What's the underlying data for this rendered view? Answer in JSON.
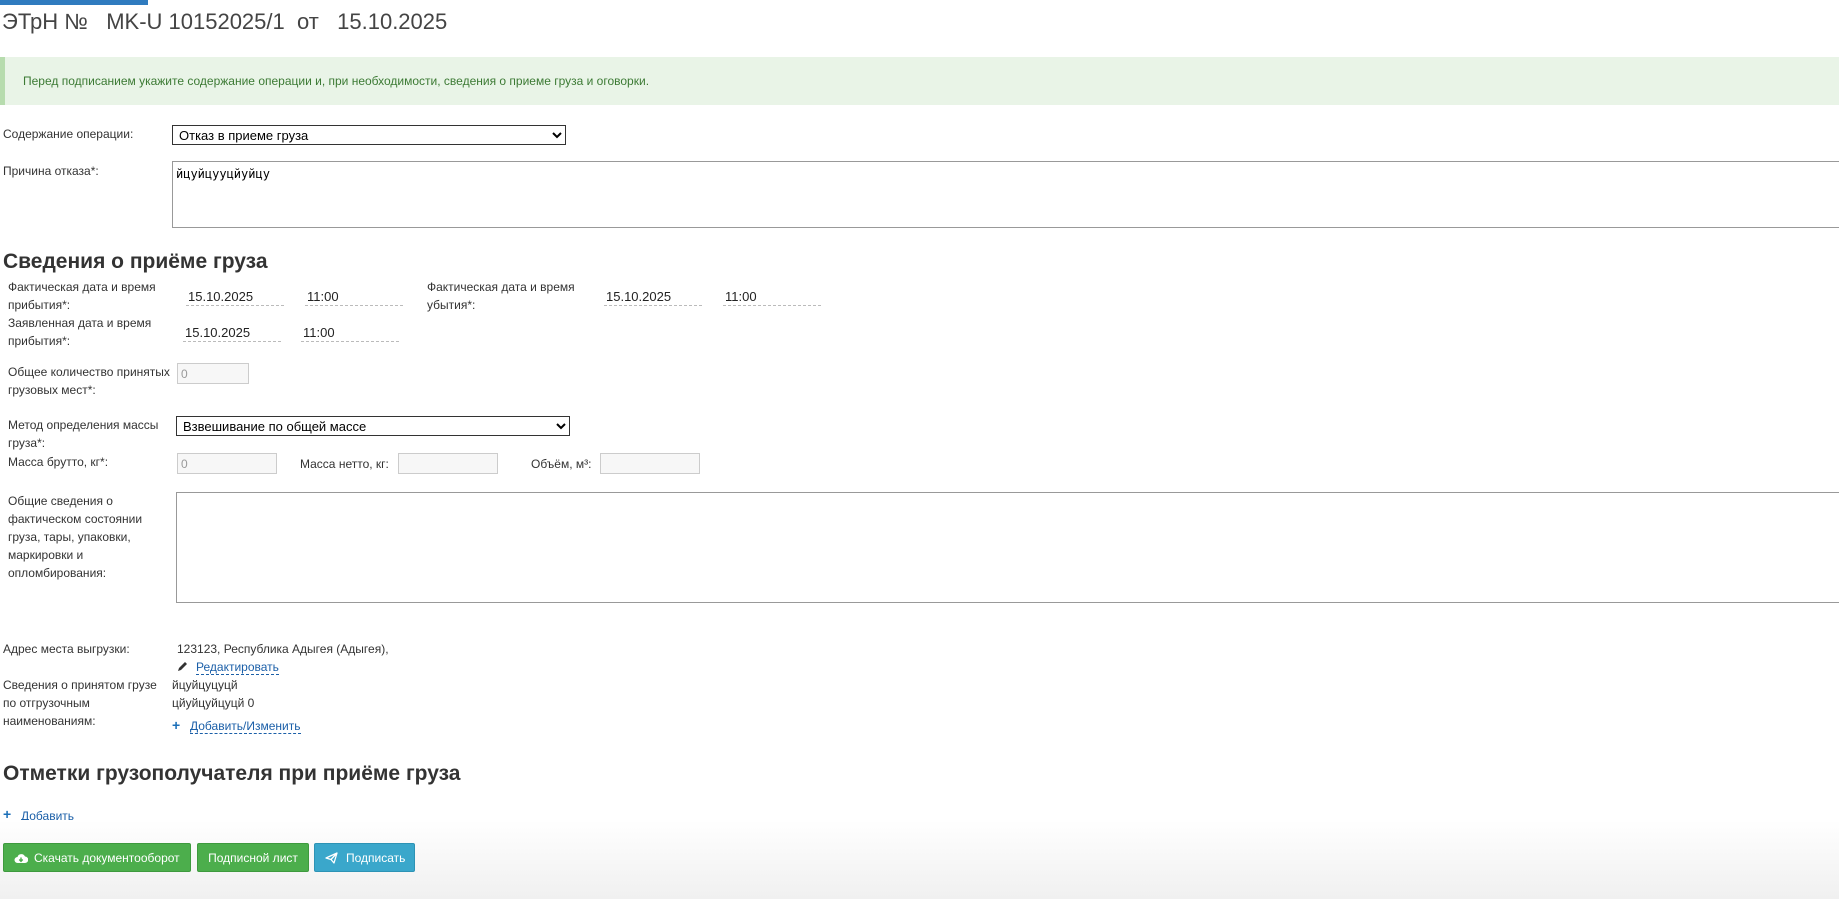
{
  "header": {
    "title": "ЭТрН №   MK-U 10152025/1  от   15.10.2025"
  },
  "notice": {
    "text": "Перед подписанием укажите содержание операции и, при необходимости, сведения о приеме груза и оговорки."
  },
  "operation": {
    "label": "Содержание операции:",
    "selected": "Отказ в приеме груза"
  },
  "refusal": {
    "label": "Причина отказа*:",
    "value": "йцуйцууцйуйцу"
  },
  "cargo_receipt": {
    "heading": "Сведения о приёме груза",
    "actual_arrival": {
      "label": "Фактическая дата и время прибытия*:",
      "date": "15.10.2025",
      "time": "11:00"
    },
    "actual_departure": {
      "label": "Фактическая дата и время убытия*:",
      "date": "15.10.2025",
      "time": "11:00"
    },
    "declared_arrival": {
      "label": "Заявленная дата и время прибытия*:",
      "date": "15.10.2025",
      "time": "11:00"
    },
    "places": {
      "label": "Общее количество принятых грузовых мест*:",
      "value": "0"
    },
    "mass_method": {
      "label": "Метод определения массы груза*:",
      "selected": "Взвешивание по общей массе"
    },
    "gross": {
      "label": "Масса брутто, кг*:",
      "value": "0"
    },
    "net": {
      "label": "Масса нетто, кг:",
      "value": ""
    },
    "volume": {
      "label": "Объём, м³:",
      "value": ""
    },
    "condition": {
      "label": "Общие сведения о фактическом состоянии груза, тары, упаковки, маркировки и опломбирования:",
      "value": ""
    },
    "unload_address": {
      "label": "Адрес места выгрузки:",
      "value": "123123, Республика Адыгея (Адыгея),",
      "edit_link": "Редактировать"
    },
    "shipping_items": {
      "label": "Сведения о принятом грузе по отгрузочным наименованиям:",
      "line1": "йцуйцуцуцй",
      "line2": "цйуйцуйцуцй 0",
      "add_link": "Добавить/Изменить"
    }
  },
  "consignee_marks": {
    "heading": "Отметки грузополучателя при приёме груза",
    "add_link": "Добавить"
  },
  "actions": {
    "download": "Скачать документооборот",
    "signature_sheet": "Подписной лист",
    "sign": "Подписать"
  },
  "colors": {
    "accent_blue": "#2f7bbf",
    "notice_bg": "#e9f4e7",
    "notice_text": "#3c7a34",
    "button_green": "#4cae4c",
    "button_blue": "#3aa7cb",
    "link": "#1b5fa8"
  }
}
